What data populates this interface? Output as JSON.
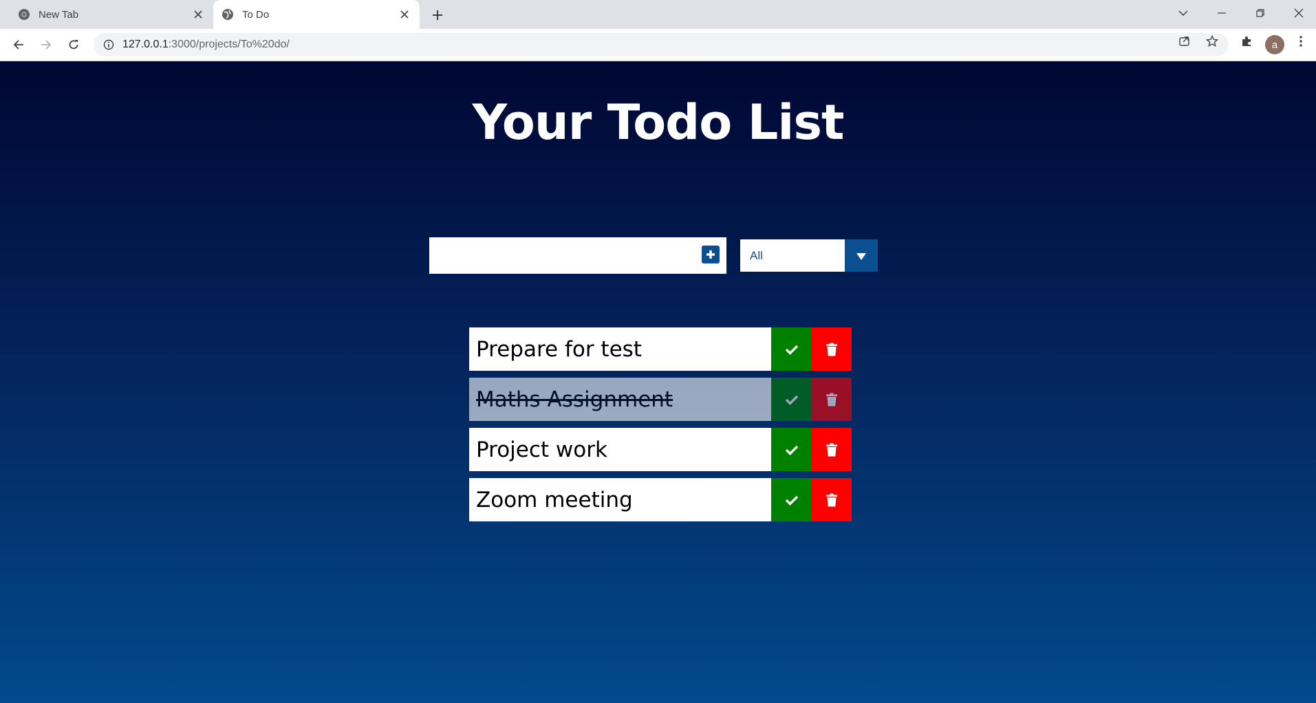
{
  "browser": {
    "tabs": [
      {
        "label": "New Tab",
        "active": false,
        "icon": "chrome-icon"
      },
      {
        "label": "To Do",
        "active": true,
        "icon": "globe-icon"
      }
    ],
    "address": {
      "host": "127.0.0.1",
      "path": ":3000/projects/To%20do/"
    },
    "profile_initial": "a"
  },
  "page": {
    "heading": "Your Todo List",
    "input": {
      "value": "",
      "placeholder": ""
    },
    "filter": {
      "selected": "All"
    },
    "todos": [
      {
        "text": "Prepare for test",
        "completed": false
      },
      {
        "text": "Maths Assignment",
        "completed": true
      },
      {
        "text": "Project work",
        "completed": false
      },
      {
        "text": "Zoom meeting",
        "completed": false
      }
    ]
  },
  "colors": {
    "check": "#008000",
    "trash": "#ff0000",
    "accent": "#0a4f8f"
  }
}
